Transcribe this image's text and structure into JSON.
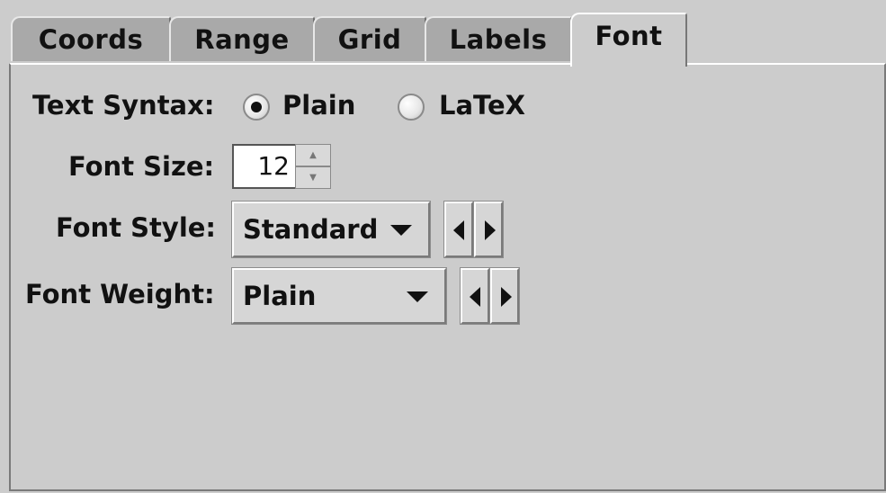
{
  "tabs": [
    {
      "label": "Coords",
      "active": false
    },
    {
      "label": "Range",
      "active": false
    },
    {
      "label": "Grid",
      "active": false
    },
    {
      "label": "Labels",
      "active": false
    },
    {
      "label": "Font",
      "active": true
    }
  ],
  "text_syntax": {
    "label": "Text Syntax:",
    "options": [
      {
        "label": "Plain",
        "selected": true
      },
      {
        "label": "LaTeX",
        "selected": false
      }
    ]
  },
  "font_size": {
    "label": "Font Size:",
    "value": "12"
  },
  "font_style": {
    "label": "Font Style:",
    "value": "Standard"
  },
  "font_weight": {
    "label": "Font Weight:",
    "value": "Plain"
  },
  "colors": {
    "panel": "#cccccc",
    "inactive_tab": "#a9a9a9"
  }
}
